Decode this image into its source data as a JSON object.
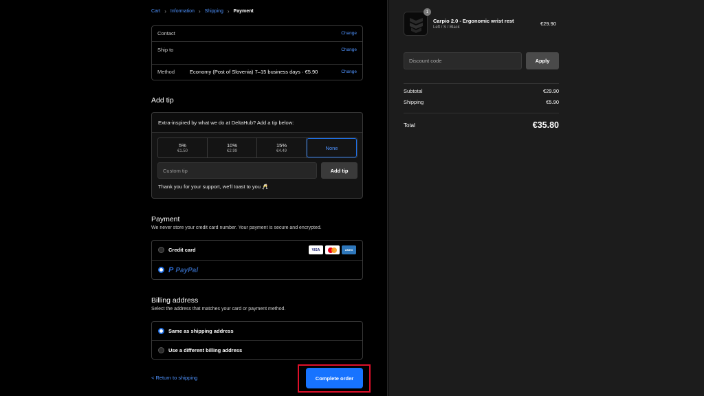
{
  "breadcrumb": {
    "items": [
      "Cart",
      "Information",
      "Shipping"
    ],
    "current": "Payment"
  },
  "review": {
    "contact_label": "Contact",
    "contact_value": "",
    "ship_to_label": "Ship to",
    "ship_to_value": "",
    "method_label": "Method",
    "method_value": "Economy (Post of Slovenia) 7–15 business days · €5.90",
    "change_label": "Change"
  },
  "tip": {
    "heading": "Add tip",
    "prompt": "Extra-inspired by what we do at DeltaHub? Add a tip below:",
    "options": [
      {
        "pct": "5%",
        "amount": "€1.50"
      },
      {
        "pct": "10%",
        "amount": "€2.99"
      },
      {
        "pct": "15%",
        "amount": "€4.49"
      },
      {
        "pct": "None",
        "amount": ""
      }
    ],
    "selected": "None",
    "custom_placeholder": "Custom tip",
    "add_button": "Add tip",
    "thanks": "Thank you for your support, we'll toast to you 🥂"
  },
  "payment": {
    "heading": "Payment",
    "subtext": "We never store your credit card number. Your payment is secure and encrypted.",
    "credit_card_label": "Credit card",
    "card_brands": [
      "VISA",
      "Mastercard",
      "AMEX"
    ],
    "paypal_label": "PayPal",
    "selected": "PayPal"
  },
  "billing": {
    "heading": "Billing address",
    "subtext": "Select the address that matches your card or payment method.",
    "same_label": "Same as shipping address",
    "different_label": "Use a different billing address",
    "selected": "same"
  },
  "footer": {
    "return_label": "< Return to shipping",
    "complete_label": "Complete order"
  },
  "summary": {
    "product": {
      "name": "Carpio 2.0 - Ergonomic wrist rest",
      "variant": "Left / S / Black",
      "price": "€29.90",
      "quantity": "1"
    },
    "discount_placeholder": "Discount code",
    "apply_label": "Apply",
    "subtotal_label": "Subtotal",
    "subtotal_value": "€29.90",
    "shipping_label": "Shipping",
    "shipping_value": "€5.90",
    "total_label": "Total",
    "total_value": "€35.80"
  },
  "colors": {
    "accent": "#1773ff",
    "link": "#4f93ff",
    "highlight": "#e0102a"
  }
}
